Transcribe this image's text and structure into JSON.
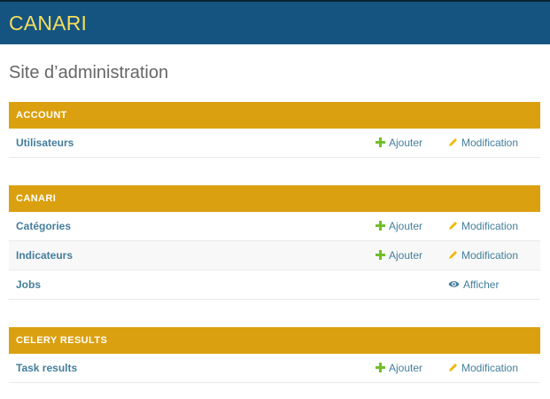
{
  "header": {
    "brand": "CANARI"
  },
  "page_title": "Site d’administration",
  "colors": {
    "header_bg": "#155480",
    "brand_text": "#f5dd5d",
    "module_caption_bg": "#dba00f",
    "link": "#447e9b",
    "add_icon": "#70bf2b",
    "change_icon": "#efb80b"
  },
  "modules": [
    {
      "caption": "ACCOUNT",
      "models": [
        {
          "name": "Utilisateurs",
          "add_label": "Ajouter",
          "change_label": "Modification",
          "add_icon": "plus-icon",
          "change_icon": "pencil-icon"
        }
      ]
    },
    {
      "caption": "CANARI",
      "models": [
        {
          "name": "Catégories",
          "add_label": "Ajouter",
          "change_label": "Modification",
          "add_icon": "plus-icon",
          "change_icon": "pencil-icon"
        },
        {
          "name": "Indicateurs",
          "add_label": "Ajouter",
          "change_label": "Modification",
          "add_icon": "plus-icon",
          "change_icon": "pencil-icon"
        },
        {
          "name": "Jobs",
          "view_label": "Afficher",
          "view_icon": "eye-icon"
        }
      ]
    },
    {
      "caption": "CELERY RESULTS",
      "models": [
        {
          "name": "Task results",
          "add_label": "Ajouter",
          "change_label": "Modification",
          "add_icon": "plus-icon",
          "change_icon": "pencil-icon"
        }
      ]
    }
  ]
}
